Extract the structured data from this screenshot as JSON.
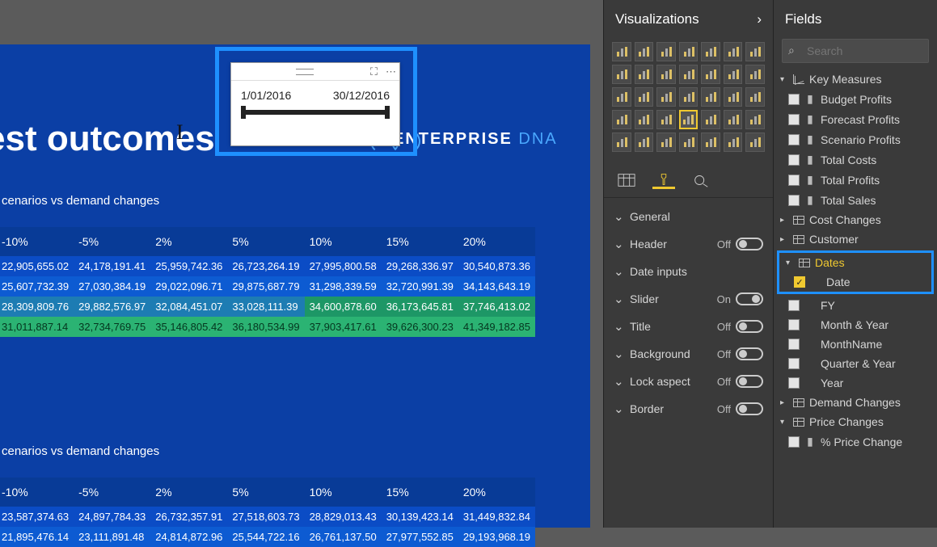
{
  "page_title": "est outcomes",
  "logo_text": "ENTERPRISE",
  "logo_accent": "DNA",
  "slicer": {
    "start": "1/01/2016",
    "end": "30/12/2016"
  },
  "matrix1": {
    "title": "cenarios vs demand changes",
    "headers": [
      "-10%",
      "-5%",
      "2%",
      "5%",
      "10%",
      "15%",
      "20%"
    ],
    "rows": [
      [
        "22,905,655.02",
        "24,178,191.41",
        "25,959,742.36",
        "26,723,264.19",
        "27,995,800.58",
        "29,268,336.97",
        "30,540,873.36"
      ],
      [
        "25,607,732.39",
        "27,030,384.19",
        "29,022,096.71",
        "29,875,687.79",
        "31,298,339.59",
        "32,720,991.39",
        "34,143,643.19"
      ],
      [
        "28,309,809.76",
        "29,882,576.97",
        "32,084,451.07",
        "33,028,111.39",
        "34,600,878.60",
        "36,173,645.81",
        "37,746,413.02"
      ],
      [
        "31,011,887.14",
        "32,734,769.75",
        "35,146,805.42",
        "36,180,534.99",
        "37,903,417.61",
        "39,626,300.23",
        "41,349,182.85"
      ]
    ]
  },
  "matrix2": {
    "title": "cenarios vs demand changes",
    "headers": [
      "-10%",
      "-5%",
      "2%",
      "5%",
      "10%",
      "15%",
      "20%"
    ],
    "rows": [
      [
        "23,587,374.63",
        "24,897,784.33",
        "26,732,357.91",
        "27,518,603.73",
        "28,829,013.43",
        "30,139,423.14",
        "31,449,832.84"
      ],
      [
        "21,895,476.14",
        "23,111,891.48",
        "24,814,872.96",
        "25,544,722.16",
        "26,761,137.50",
        "27,977,552.85",
        "29,193,968.19"
      ]
    ]
  },
  "vis_pane_title": "Visualizations",
  "viz_icons": [
    [
      "stacked-bar",
      "clustered-bar",
      "stacked-col",
      "clustered-col",
      "stacked-bar-100",
      "stacked-col-100",
      "ribbon"
    ],
    [
      "line",
      "area",
      "stacked-area",
      "line-col",
      "line-col-stacked",
      "waterfall",
      "scatter"
    ],
    [
      "pie",
      "donut",
      "treemap",
      "map",
      "filled-map",
      "funnel",
      "gauge"
    ],
    [
      "card",
      "multi-card",
      "kpi",
      "slicer",
      "table",
      "matrix",
      "r"
    ],
    [
      "py",
      "key-influencers",
      "decomposition",
      "qa",
      "paginated",
      "more",
      "ellipsis"
    ]
  ],
  "viz_selected": "slicer",
  "fmt_sections": [
    {
      "name": "General",
      "state": null
    },
    {
      "name": "Header",
      "state": "Off"
    },
    {
      "name": "Date inputs",
      "state": null
    },
    {
      "name": "Slider",
      "state": "On"
    },
    {
      "name": "Title",
      "state": "Off"
    },
    {
      "name": "Background",
      "state": "Off"
    },
    {
      "name": "Lock aspect",
      "state": "Off"
    },
    {
      "name": "Border",
      "state": "Off"
    }
  ],
  "fields_pane_title": "Fields",
  "search_placeholder": "Search",
  "tables": [
    {
      "name": "Key Measures",
      "expanded": true,
      "icon": "measure",
      "fields": [
        {
          "name": "Budget Profits",
          "checked": false,
          "measure": true
        },
        {
          "name": "Forecast Profits",
          "checked": false,
          "measure": true
        },
        {
          "name": "Scenario Profits",
          "checked": false,
          "measure": true
        },
        {
          "name": "Total Costs",
          "checked": false,
          "measure": true
        },
        {
          "name": "Total Profits",
          "checked": false,
          "measure": true
        },
        {
          "name": "Total Sales",
          "checked": false,
          "measure": true
        }
      ]
    },
    {
      "name": "Cost Changes",
      "expanded": false,
      "icon": "table"
    },
    {
      "name": "Customer",
      "expanded": false,
      "icon": "table"
    },
    {
      "name": "Dates",
      "expanded": true,
      "icon": "table",
      "selected": true,
      "fields": [
        {
          "name": "Date",
          "checked": true,
          "highlighted": true
        },
        {
          "name": "FY",
          "checked": false
        },
        {
          "name": "Month & Year",
          "checked": false
        },
        {
          "name": "MonthName",
          "checked": false
        },
        {
          "name": "Quarter & Year",
          "checked": false
        },
        {
          "name": "Year",
          "checked": false
        }
      ]
    },
    {
      "name": "Demand Changes",
      "expanded": false,
      "icon": "table"
    },
    {
      "name": "Price Changes",
      "expanded": true,
      "icon": "table",
      "fields": [
        {
          "name": "% Price Change",
          "checked": false,
          "measure": true
        }
      ]
    }
  ]
}
